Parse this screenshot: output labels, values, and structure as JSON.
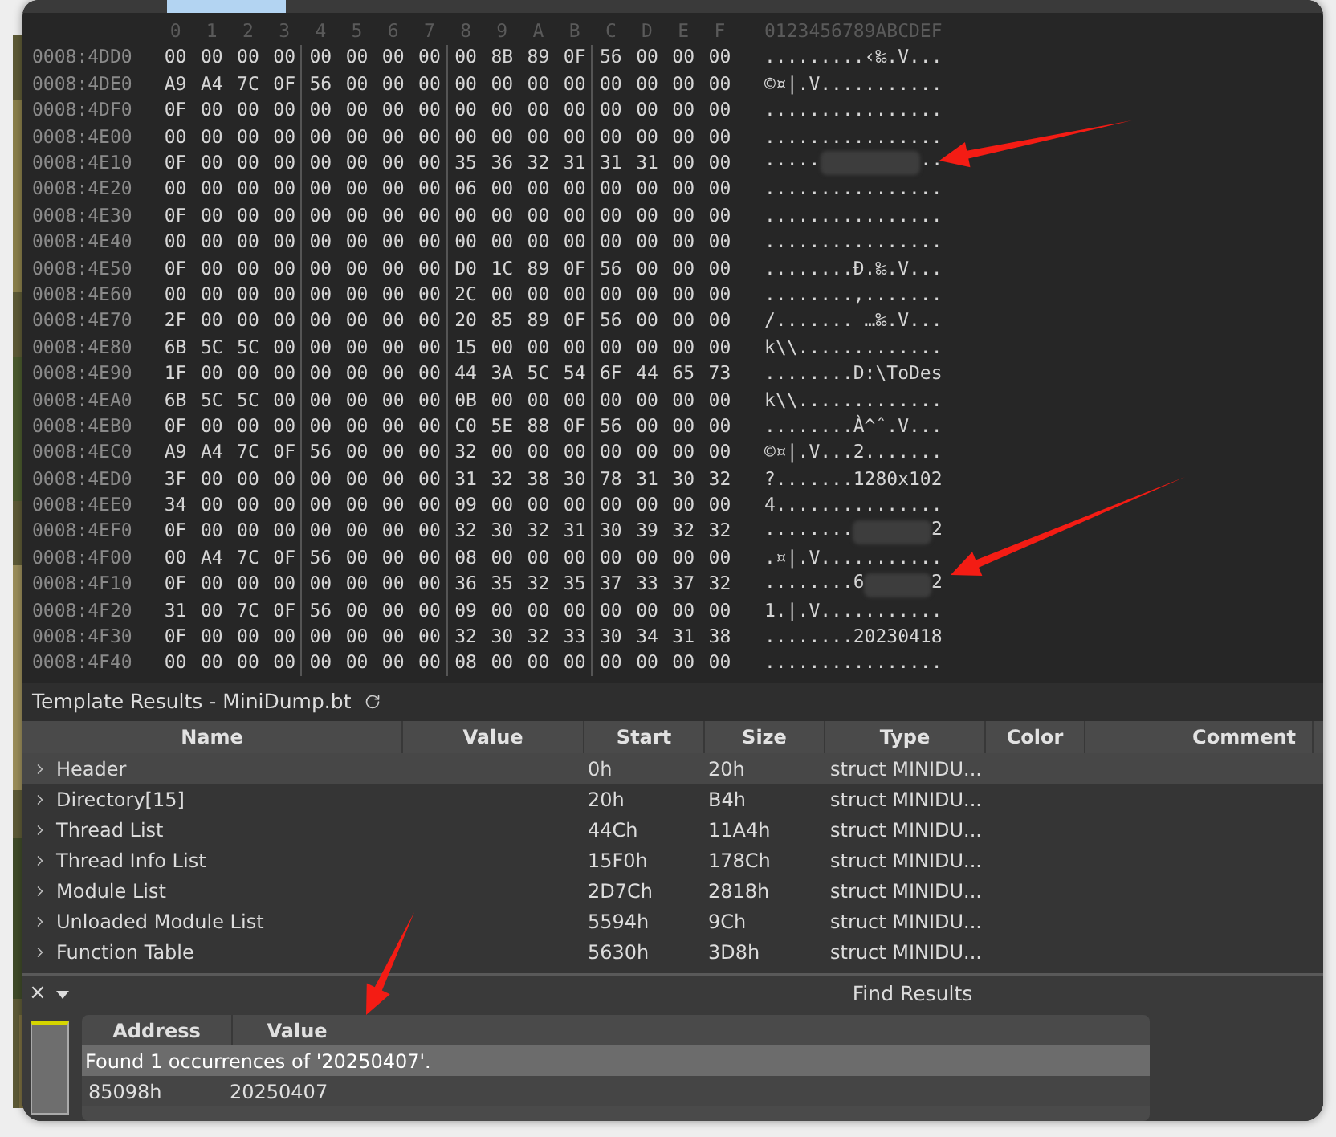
{
  "hex_view": {
    "column_headers": [
      "0",
      "1",
      "2",
      "3",
      "4",
      "5",
      "6",
      "7",
      "8",
      "9",
      "A",
      "B",
      "C",
      "D",
      "E",
      "F"
    ],
    "ascii_header": "0123456789ABCDEF",
    "rows": [
      {
        "address": "0008:4DD0",
        "bytes": "00 00 00 00 00 00 00 00 00 8B 89 0F 56 00 00 00",
        "ascii": ".........‹‰.V..."
      },
      {
        "address": "0008:4DE0",
        "bytes": "A9 A4 7C 0F 56 00 00 00 00 00 00 00 00 00 00 00",
        "ascii": "©¤|.V..........."
      },
      {
        "address": "0008:4DF0",
        "bytes": "0F 00 00 00 00 00 00 00 00 00 00 00 00 00 00 00",
        "ascii": "................"
      },
      {
        "address": "0008:4E00",
        "bytes": "00 00 00 00 00 00 00 00 00 00 00 00 00 00 00 00",
        "ascii": "................"
      },
      {
        "address": "0008:4E10",
        "bytes": "0F 00 00 00 00 00 00 00 35 36 32 31 31 31 00 00",
        "ascii_parts": [
          {
            "kind": "text",
            "text": "....."
          },
          {
            "kind": "redacted"
          },
          {
            "kind": "text",
            "text": ".."
          }
        ]
      },
      {
        "address": "0008:4E20",
        "bytes": "00 00 00 00 00 00 00 00 06 00 00 00 00 00 00 00",
        "ascii": "................"
      },
      {
        "address": "0008:4E30",
        "bytes": "0F 00 00 00 00 00 00 00 00 00 00 00 00 00 00 00",
        "ascii": "................"
      },
      {
        "address": "0008:4E40",
        "bytes": "00 00 00 00 00 00 00 00 00 00 00 00 00 00 00 00",
        "ascii": "................"
      },
      {
        "address": "0008:4E50",
        "bytes": "0F 00 00 00 00 00 00 00 D0 1C 89 0F 56 00 00 00",
        "ascii": "........Ð.‰.V..."
      },
      {
        "address": "0008:4E60",
        "bytes": "00 00 00 00 00 00 00 00 2C 00 00 00 00 00 00 00",
        "ascii": "........,......."
      },
      {
        "address": "0008:4E70",
        "bytes": "2F 00 00 00 00 00 00 00 20 85 89 0F 56 00 00 00",
        "ascii": "/....... …‰.V..."
      },
      {
        "address": "0008:4E80",
        "bytes": "6B 5C 5C 00 00 00 00 00 15 00 00 00 00 00 00 00",
        "ascii": "k\\\\............."
      },
      {
        "address": "0008:4E90",
        "bytes": "1F 00 00 00 00 00 00 00 44 3A 5C 54 6F 44 65 73",
        "ascii": "........D:\\ToDes"
      },
      {
        "address": "0008:4EA0",
        "bytes": "6B 5C 5C 00 00 00 00 00 0B 00 00 00 00 00 00 00",
        "ascii": "k\\\\............."
      },
      {
        "address": "0008:4EB0",
        "bytes": "0F 00 00 00 00 00 00 00 C0 5E 88 0F 56 00 00 00",
        "ascii": "........À^ˆ.V..."
      },
      {
        "address": "0008:4EC0",
        "bytes": "A9 A4 7C 0F 56 00 00 00 32 00 00 00 00 00 00 00",
        "ascii": "©¤|.V...2......."
      },
      {
        "address": "0008:4ED0",
        "bytes": "3F 00 00 00 00 00 00 00 31 32 38 30 78 31 30 32",
        "ascii": "?.......1280x102"
      },
      {
        "address": "0008:4EE0",
        "bytes": "34 00 00 00 00 00 00 00 09 00 00 00 00 00 00 00",
        "ascii": "4..............."
      },
      {
        "address": "0008:4EF0",
        "bytes": "0F 00 00 00 00 00 00 00 32 30 32 31 30 39 32 32",
        "ascii_parts": [
          {
            "kind": "text",
            "text": "........"
          },
          {
            "kind": "redacted"
          },
          {
            "kind": "text",
            "text": "2"
          }
        ]
      },
      {
        "address": "0008:4F00",
        "bytes": "00 A4 7C 0F 56 00 00 00 08 00 00 00 00 00 00 00",
        "ascii": ".¤|.V..........."
      },
      {
        "address": "0008:4F10",
        "bytes": "0F 00 00 00 00 00 00 00 36 35 32 35 37 33 37 32",
        "ascii_parts": [
          {
            "kind": "text",
            "text": "........6"
          },
          {
            "kind": "redacted"
          },
          {
            "kind": "text",
            "text": "2"
          }
        ]
      },
      {
        "address": "0008:4F20",
        "bytes": "31 00 7C 0F 56 00 00 00 09 00 00 00 00 00 00 00",
        "ascii": "1.|.V..........."
      },
      {
        "address": "0008:4F30",
        "bytes": "0F 00 00 00 00 00 00 00 32 30 32 33 30 34 31 38",
        "ascii": "........20230418"
      },
      {
        "address": "0008:4F40",
        "bytes": "00 00 00 00 00 00 00 00 08 00 00 00 00 00 00 00",
        "ascii": "................"
      }
    ]
  },
  "template_results": {
    "title": "Template Results - MiniDump.bt",
    "columns": [
      "Name",
      "Value",
      "Start",
      "Size",
      "Type",
      "Color",
      "Comment"
    ],
    "rows": [
      {
        "name": "Header",
        "start": "0h",
        "size": "20h",
        "type": "struct MINIDU...",
        "selected": true,
        "expanded": false
      },
      {
        "name": "Directory[15]",
        "start": "20h",
        "size": "B4h",
        "type": "struct MINIDU...",
        "selected": false,
        "expanded": false
      },
      {
        "name": "Thread List",
        "start": "44Ch",
        "size": "11A4h",
        "type": "struct MINIDU...",
        "selected": false,
        "expanded": false
      },
      {
        "name": "Thread Info List",
        "start": "15F0h",
        "size": "178Ch",
        "type": "struct MINIDU...",
        "selected": false,
        "expanded": false
      },
      {
        "name": "Module List",
        "start": "2D7Ch",
        "size": "2818h",
        "type": "struct MINIDU...",
        "selected": false,
        "expanded": false
      },
      {
        "name": "Unloaded Module List",
        "start": "5594h",
        "size": "9Ch",
        "type": "struct MINIDU...",
        "selected": false,
        "expanded": false
      },
      {
        "name": "Function Table",
        "start": "5630h",
        "size": "3D8h",
        "type": "struct MINIDU...",
        "selected": false,
        "expanded": false
      }
    ]
  },
  "find_results": {
    "close": "×",
    "title": "Find Results",
    "columns": [
      "Address",
      "Value"
    ],
    "message": "Found 1 occurrences of '20250407'.",
    "results": [
      {
        "address": "85098h",
        "value": "20250407"
      }
    ]
  }
}
